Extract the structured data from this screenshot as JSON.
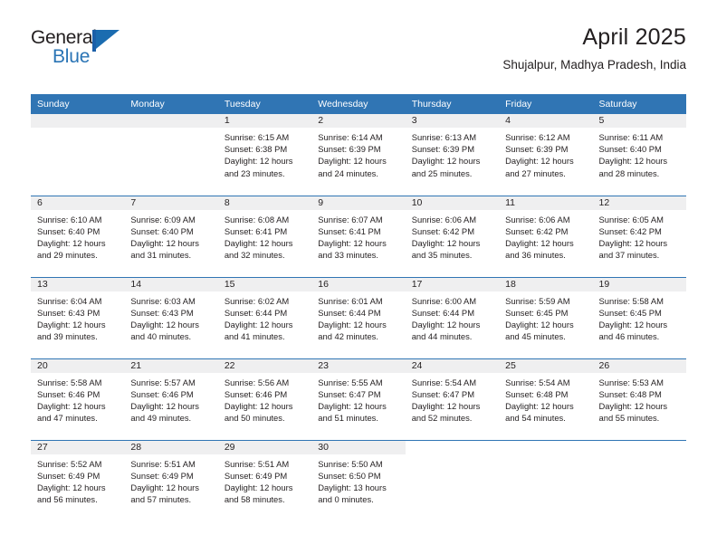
{
  "brand": {
    "name_top": "General",
    "name_bottom": "Blue",
    "flag_icon": "blue-flag-triangle-icon",
    "accent_color": "#2a74b5"
  },
  "header": {
    "title": "April 2025",
    "subtitle": "Shujalpur, Madhya Pradesh, India"
  },
  "colors": {
    "header_blue": "#3075b4",
    "daynum_band": "#efeff0",
    "row_separator": "#3075b4",
    "text": "#231f20"
  },
  "calendar": {
    "weekday_headers": [
      "Sunday",
      "Monday",
      "Tuesday",
      "Wednesday",
      "Thursday",
      "Friday",
      "Saturday"
    ],
    "weeks": [
      [
        {
          "day": "",
          "sunrise": "",
          "sunset": "",
          "daylight_1": "",
          "daylight_2": ""
        },
        {
          "day": "",
          "sunrise": "",
          "sunset": "",
          "daylight_1": "",
          "daylight_2": ""
        },
        {
          "day": "1",
          "sunrise": "Sunrise: 6:15 AM",
          "sunset": "Sunset: 6:38 PM",
          "daylight_1": "Daylight: 12 hours",
          "daylight_2": "and 23 minutes."
        },
        {
          "day": "2",
          "sunrise": "Sunrise: 6:14 AM",
          "sunset": "Sunset: 6:39 PM",
          "daylight_1": "Daylight: 12 hours",
          "daylight_2": "and 24 minutes."
        },
        {
          "day": "3",
          "sunrise": "Sunrise: 6:13 AM",
          "sunset": "Sunset: 6:39 PM",
          "daylight_1": "Daylight: 12 hours",
          "daylight_2": "and 25 minutes."
        },
        {
          "day": "4",
          "sunrise": "Sunrise: 6:12 AM",
          "sunset": "Sunset: 6:39 PM",
          "daylight_1": "Daylight: 12 hours",
          "daylight_2": "and 27 minutes."
        },
        {
          "day": "5",
          "sunrise": "Sunrise: 6:11 AM",
          "sunset": "Sunset: 6:40 PM",
          "daylight_1": "Daylight: 12 hours",
          "daylight_2": "and 28 minutes."
        }
      ],
      [
        {
          "day": "6",
          "sunrise": "Sunrise: 6:10 AM",
          "sunset": "Sunset: 6:40 PM",
          "daylight_1": "Daylight: 12 hours",
          "daylight_2": "and 29 minutes."
        },
        {
          "day": "7",
          "sunrise": "Sunrise: 6:09 AM",
          "sunset": "Sunset: 6:40 PM",
          "daylight_1": "Daylight: 12 hours",
          "daylight_2": "and 31 minutes."
        },
        {
          "day": "8",
          "sunrise": "Sunrise: 6:08 AM",
          "sunset": "Sunset: 6:41 PM",
          "daylight_1": "Daylight: 12 hours",
          "daylight_2": "and 32 minutes."
        },
        {
          "day": "9",
          "sunrise": "Sunrise: 6:07 AM",
          "sunset": "Sunset: 6:41 PM",
          "daylight_1": "Daylight: 12 hours",
          "daylight_2": "and 33 minutes."
        },
        {
          "day": "10",
          "sunrise": "Sunrise: 6:06 AM",
          "sunset": "Sunset: 6:42 PM",
          "daylight_1": "Daylight: 12 hours",
          "daylight_2": "and 35 minutes."
        },
        {
          "day": "11",
          "sunrise": "Sunrise: 6:06 AM",
          "sunset": "Sunset: 6:42 PM",
          "daylight_1": "Daylight: 12 hours",
          "daylight_2": "and 36 minutes."
        },
        {
          "day": "12",
          "sunrise": "Sunrise: 6:05 AM",
          "sunset": "Sunset: 6:42 PM",
          "daylight_1": "Daylight: 12 hours",
          "daylight_2": "and 37 minutes."
        }
      ],
      [
        {
          "day": "13",
          "sunrise": "Sunrise: 6:04 AM",
          "sunset": "Sunset: 6:43 PM",
          "daylight_1": "Daylight: 12 hours",
          "daylight_2": "and 39 minutes."
        },
        {
          "day": "14",
          "sunrise": "Sunrise: 6:03 AM",
          "sunset": "Sunset: 6:43 PM",
          "daylight_1": "Daylight: 12 hours",
          "daylight_2": "and 40 minutes."
        },
        {
          "day": "15",
          "sunrise": "Sunrise: 6:02 AM",
          "sunset": "Sunset: 6:44 PM",
          "daylight_1": "Daylight: 12 hours",
          "daylight_2": "and 41 minutes."
        },
        {
          "day": "16",
          "sunrise": "Sunrise: 6:01 AM",
          "sunset": "Sunset: 6:44 PM",
          "daylight_1": "Daylight: 12 hours",
          "daylight_2": "and 42 minutes."
        },
        {
          "day": "17",
          "sunrise": "Sunrise: 6:00 AM",
          "sunset": "Sunset: 6:44 PM",
          "daylight_1": "Daylight: 12 hours",
          "daylight_2": "and 44 minutes."
        },
        {
          "day": "18",
          "sunrise": "Sunrise: 5:59 AM",
          "sunset": "Sunset: 6:45 PM",
          "daylight_1": "Daylight: 12 hours",
          "daylight_2": "and 45 minutes."
        },
        {
          "day": "19",
          "sunrise": "Sunrise: 5:58 AM",
          "sunset": "Sunset: 6:45 PM",
          "daylight_1": "Daylight: 12 hours",
          "daylight_2": "and 46 minutes."
        }
      ],
      [
        {
          "day": "20",
          "sunrise": "Sunrise: 5:58 AM",
          "sunset": "Sunset: 6:46 PM",
          "daylight_1": "Daylight: 12 hours",
          "daylight_2": "and 47 minutes."
        },
        {
          "day": "21",
          "sunrise": "Sunrise: 5:57 AM",
          "sunset": "Sunset: 6:46 PM",
          "daylight_1": "Daylight: 12 hours",
          "daylight_2": "and 49 minutes."
        },
        {
          "day": "22",
          "sunrise": "Sunrise: 5:56 AM",
          "sunset": "Sunset: 6:46 PM",
          "daylight_1": "Daylight: 12 hours",
          "daylight_2": "and 50 minutes."
        },
        {
          "day": "23",
          "sunrise": "Sunrise: 5:55 AM",
          "sunset": "Sunset: 6:47 PM",
          "daylight_1": "Daylight: 12 hours",
          "daylight_2": "and 51 minutes."
        },
        {
          "day": "24",
          "sunrise": "Sunrise: 5:54 AM",
          "sunset": "Sunset: 6:47 PM",
          "daylight_1": "Daylight: 12 hours",
          "daylight_2": "and 52 minutes."
        },
        {
          "day": "25",
          "sunrise": "Sunrise: 5:54 AM",
          "sunset": "Sunset: 6:48 PM",
          "daylight_1": "Daylight: 12 hours",
          "daylight_2": "and 54 minutes."
        },
        {
          "day": "26",
          "sunrise": "Sunrise: 5:53 AM",
          "sunset": "Sunset: 6:48 PM",
          "daylight_1": "Daylight: 12 hours",
          "daylight_2": "and 55 minutes."
        }
      ],
      [
        {
          "day": "27",
          "sunrise": "Sunrise: 5:52 AM",
          "sunset": "Sunset: 6:49 PM",
          "daylight_1": "Daylight: 12 hours",
          "daylight_2": "and 56 minutes."
        },
        {
          "day": "28",
          "sunrise": "Sunrise: 5:51 AM",
          "sunset": "Sunset: 6:49 PM",
          "daylight_1": "Daylight: 12 hours",
          "daylight_2": "and 57 minutes."
        },
        {
          "day": "29",
          "sunrise": "Sunrise: 5:51 AM",
          "sunset": "Sunset: 6:49 PM",
          "daylight_1": "Daylight: 12 hours",
          "daylight_2": "and 58 minutes."
        },
        {
          "day": "30",
          "sunrise": "Sunrise: 5:50 AM",
          "sunset": "Sunset: 6:50 PM",
          "daylight_1": "Daylight: 13 hours",
          "daylight_2": "and 0 minutes."
        },
        {
          "day": "",
          "sunrise": "",
          "sunset": "",
          "daylight_1": "",
          "daylight_2": ""
        },
        {
          "day": "",
          "sunrise": "",
          "sunset": "",
          "daylight_1": "",
          "daylight_2": ""
        },
        {
          "day": "",
          "sunrise": "",
          "sunset": "",
          "daylight_1": "",
          "daylight_2": ""
        }
      ]
    ]
  }
}
